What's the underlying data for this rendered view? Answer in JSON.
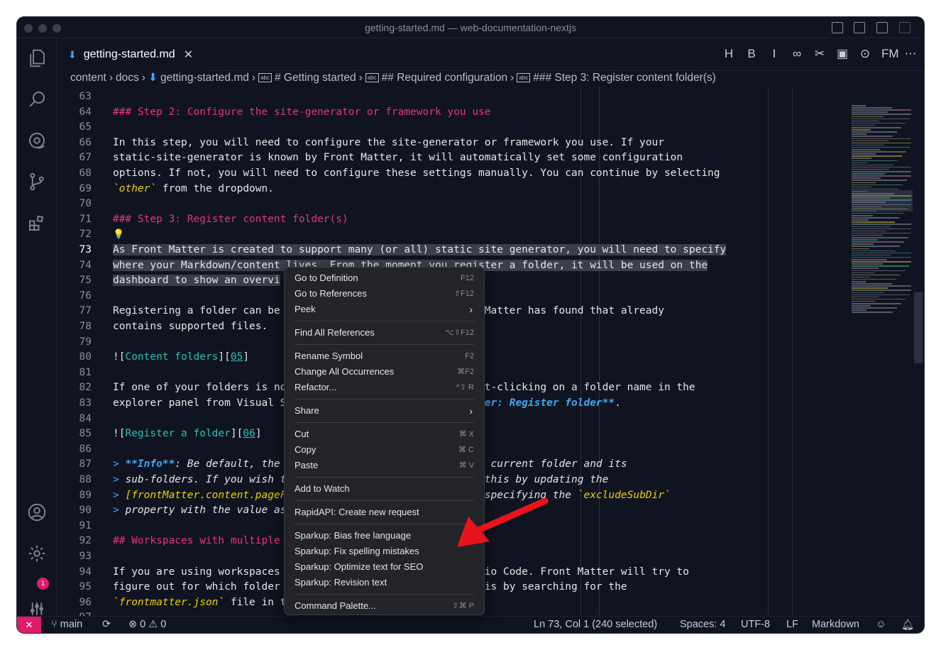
{
  "window": {
    "title": "getting-started.md — web-documentation-nextjs"
  },
  "tab": {
    "label": "getting-started.md",
    "close": "✕"
  },
  "editor_actions": [
    "H",
    "B",
    "I",
    "∞",
    "✂",
    "▣",
    "⊙",
    "FM",
    "⋯"
  ],
  "breadcrumb": [
    "content",
    "docs",
    "getting-started.md",
    "# Getting started",
    "## Required configuration",
    "### Step 3: Register content folder(s)"
  ],
  "breadcrumb_sep": "›",
  "abc": "abc",
  "lines": [
    {
      "n": "63",
      "segs": []
    },
    {
      "n": "64",
      "segs": [
        [
          "h",
          "### Step 2: Configure the site-generator or framework you use"
        ]
      ]
    },
    {
      "n": "65",
      "segs": []
    },
    {
      "n": "66",
      "segs": [
        [
          "",
          "In this step, you will need to configure the site-generator or framework you use. If your"
        ]
      ]
    },
    {
      "n": "67",
      "segs": [
        [
          "",
          "static-site-generator is known by Front Matter, it will automatically set some configuration"
        ]
      ]
    },
    {
      "n": "68",
      "segs": [
        [
          "",
          "options. If not, you will need to configure these settings manually. You can continue by selecting"
        ]
      ]
    },
    {
      "n": "69",
      "segs": [
        [
          "it",
          "`other`"
        ],
        [
          "",
          " from the dropdown."
        ]
      ]
    },
    {
      "n": "70",
      "segs": []
    },
    {
      "n": "71",
      "segs": [
        [
          "h",
          "### Step 3: Register content folder(s)"
        ]
      ]
    },
    {
      "n": "72",
      "segs": [
        [
          "bulb",
          "💡"
        ]
      ]
    },
    {
      "n": "73",
      "segs": [
        [
          "sel",
          "As Front Matter is created to support many (or all) static site generator, you will need to specify"
        ]
      ],
      "active": true
    },
    {
      "n": "74",
      "segs": [
        [
          "sel",
          "where your Markdown/content lives. From the moment you register a folder, it will be used on the"
        ]
      ]
    },
    {
      "n": "75",
      "segs": [
        [
          "sel",
          "dashboard to show an overvi"
        ]
      ]
    },
    {
      "n": "76",
      "segs": []
    },
    {
      "n": "77",
      "segs": [
        [
          "",
          "Registering a folder can be                             ont Matter has found that already"
        ]
      ]
    },
    {
      "n": "78",
      "segs": [
        [
          "",
          "contains supported files."
        ]
      ]
    },
    {
      "n": "79",
      "segs": []
    },
    {
      "n": "80",
      "segs": [
        [
          "",
          "!["
        ],
        [
          "lnk",
          "Content folders"
        ],
        [
          "",
          "]["
        ],
        [
          "ref",
          "05"
        ],
        [
          "",
          "]"
        ]
      ]
    },
    {
      "n": "81",
      "segs": []
    },
    {
      "n": "82",
      "segs": [
        [
          "",
          "If one of your folders is no                            right-clicking on a folder name in the"
        ]
      ]
    },
    {
      "n": "83",
      "segs": [
        [
          "",
          "explorer panel from Visual S                            "
        ],
        [
          "bold",
          "Matter: Register folder**"
        ],
        [
          "",
          "."
        ]
      ]
    },
    {
      "n": "84",
      "segs": []
    },
    {
      "n": "85",
      "segs": [
        [
          "",
          "!["
        ],
        [
          "lnk",
          "Register a folder"
        ],
        [
          "",
          "]["
        ],
        [
          "ref",
          "06"
        ],
        [
          "",
          "]"
        ]
      ]
    },
    {
      "n": "86",
      "segs": []
    },
    {
      "n": "87",
      "segs": [
        [
          "qm",
          "> "
        ],
        [
          "bold",
          "**Info**"
        ],
        [
          "quote",
          ": Be default, the                          rom the current folder and its"
        ]
      ]
    },
    {
      "n": "88",
      "segs": [
        [
          "qm",
          "> "
        ],
        [
          "quote",
          "sub-folders. If you wish t                          an do this by updating the"
        ]
      ]
    },
    {
      "n": "89",
      "segs": [
        [
          "qm",
          "> "
        ],
        [
          "it",
          "[frontMatter.content.pageF"
        ],
        [
          "quote",
          "                          g and specifying the "
        ],
        [
          "it",
          "`excludeSubDir`"
        ]
      ]
    },
    {
      "n": "90",
      "segs": [
        [
          "qm",
          "> "
        ],
        [
          "quote",
          "property with the value as"
        ]
      ]
    },
    {
      "n": "91",
      "segs": []
    },
    {
      "n": "92",
      "segs": [
        [
          "h",
          "## Workspaces with multiple"
        ]
      ]
    },
    {
      "n": "93",
      "segs": []
    },
    {
      "n": "94",
      "segs": [
        [
          "",
          "If you are using workspaces                             Studio Code. Front Matter will try to"
        ]
      ]
    },
    {
      "n": "95",
      "segs": [
        [
          "",
          "figure out for which folder                             s this by searching for the"
        ]
      ]
    },
    {
      "n": "96",
      "segs": [
        [
          "it",
          "`frontmatter.json`"
        ],
        [
          "",
          " file in t"
        ]
      ]
    },
    {
      "n": "97",
      "segs": []
    }
  ],
  "context_menu": [
    {
      "label": "Go to Definition",
      "key": "F12"
    },
    {
      "label": "Go to References",
      "key": "⇧F12"
    },
    {
      "label": "Peek",
      "sub": "›"
    },
    {
      "sep": true
    },
    {
      "label": "Find All References",
      "key": "⌥⇧F12"
    },
    {
      "sep": true
    },
    {
      "label": "Rename Symbol",
      "key": "F2"
    },
    {
      "label": "Change All Occurrences",
      "key": "⌘F2"
    },
    {
      "label": "Refactor...",
      "key": "^⇧ R"
    },
    {
      "sep": true
    },
    {
      "label": "Share",
      "sub": "›"
    },
    {
      "sep": true
    },
    {
      "label": "Cut",
      "key": "⌘ X"
    },
    {
      "label": "Copy",
      "key": "⌘ C"
    },
    {
      "label": "Paste",
      "key": "⌘ V"
    },
    {
      "sep": true
    },
    {
      "label": "Add to Watch"
    },
    {
      "sep": true
    },
    {
      "label": "RapidAPI: Create new request"
    },
    {
      "sep": true
    },
    {
      "label": "Sparkup: Bias free language"
    },
    {
      "label": "Sparkup: Fix spelling mistakes"
    },
    {
      "label": "Sparkup: Optimize text for SEO"
    },
    {
      "label": "Sparkup: Revision text"
    },
    {
      "sep": true
    },
    {
      "label": "Command Palette...",
      "key": "⇧⌘ P"
    }
  ],
  "status": {
    "remote": "✕",
    "branch": "main",
    "sync": "⟳",
    "problems": "⊗ 0 ⚠ 0",
    "position": "Ln 73, Col 1 (240 selected)",
    "spaces": "Spaces: 4",
    "encoding": "UTF-8",
    "eol": "LF",
    "language": "Markdown"
  },
  "badge": "1",
  "colors": {
    "accent": "#e01b6a",
    "heading": "#e8347a",
    "link": "#22c5b5",
    "italic": "#f0d000",
    "arrow": "#e8141b"
  }
}
